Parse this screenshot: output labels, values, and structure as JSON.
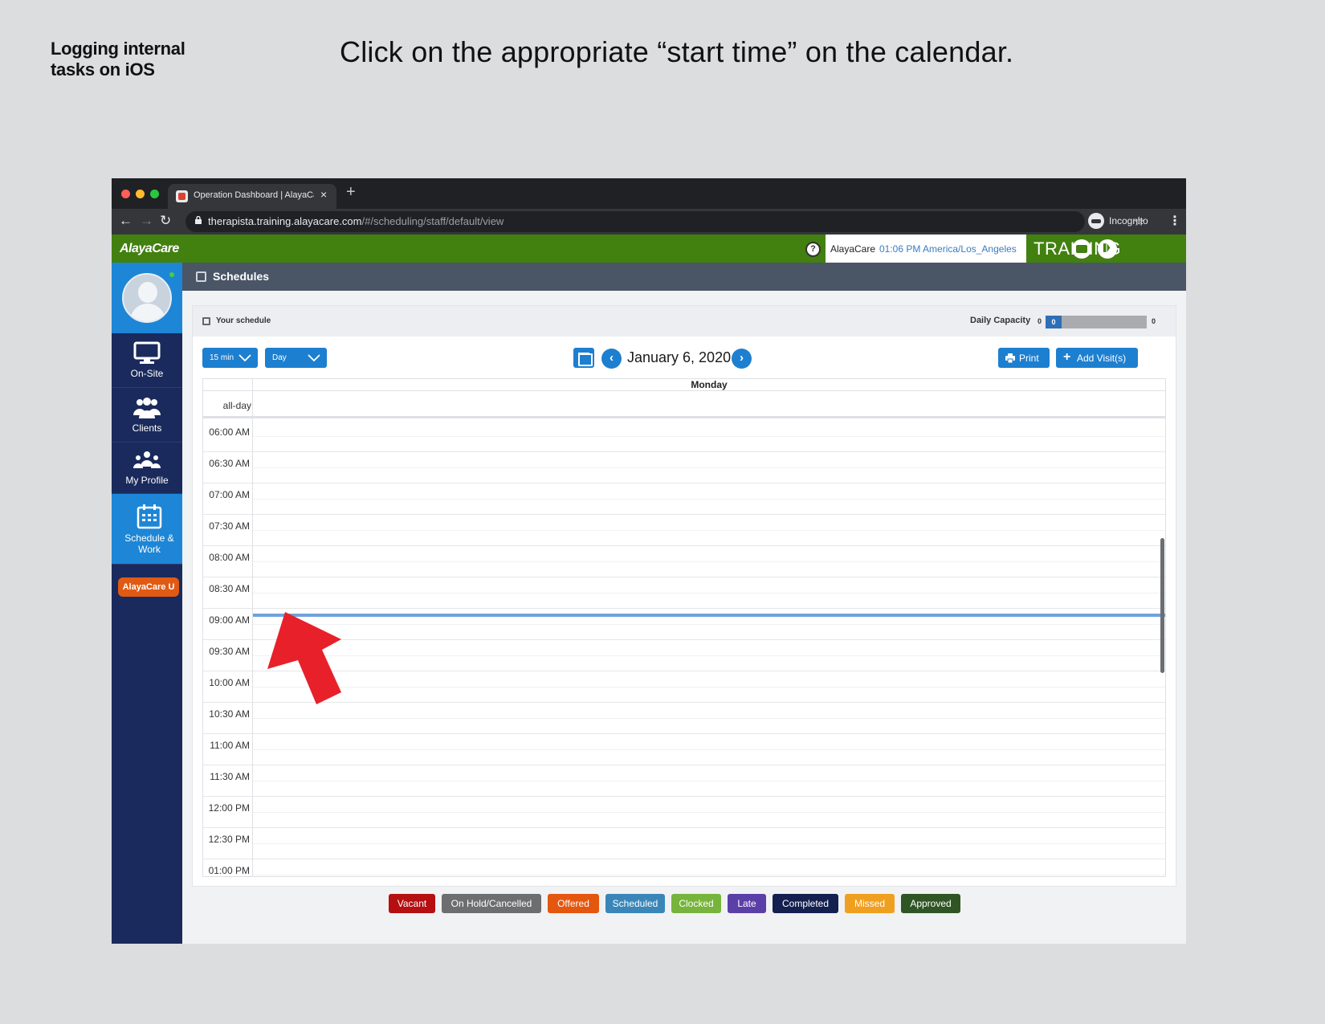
{
  "slide": {
    "tag": "Logging internal tasks on iOS",
    "instruction": "Click on the appropriate “start time” on the calendar."
  },
  "browser": {
    "tab_title": "Operation Dashboard | AlayaCare",
    "tab_close": "×",
    "new_tab": "+",
    "url_host": "therapista.training.alayacare.com",
    "url_path": "/#/scheduling/staff/default/view",
    "incognito_label": "Incognito",
    "back": "←",
    "forward": "→",
    "reload": "↻",
    "star": "☆",
    "kebab": "⋮"
  },
  "header": {
    "logo": "AlayaCare",
    "help": "?",
    "org": "AlayaCare",
    "time": "01:06 PM",
    "timezone": "America/Los_Angeles",
    "env": "TRAINING"
  },
  "sidebar": {
    "items": [
      {
        "label": "On-Site",
        "icon": "monitor-icon"
      },
      {
        "label": "Clients",
        "icon": "users-icon"
      },
      {
        "label": "My Profile",
        "icon": "group-icon"
      },
      {
        "label": "Schedule & Work",
        "icon": "calendar-icon",
        "active": true
      }
    ],
    "alaya_u": "AlayaCare U"
  },
  "page": {
    "title": "Schedules"
  },
  "panel": {
    "title": "Your schedule",
    "capacity_label": "Daily Capacity",
    "capacity_min": "0",
    "capacity_value": "0",
    "capacity_max": "0",
    "interval": "15 min",
    "view": "Day",
    "date": "January 6, 2020",
    "print": "Print",
    "add_visit": "Add Visit(s)",
    "prev": "‹",
    "next": "›"
  },
  "calendar": {
    "day": "Monday",
    "allday": "all-day",
    "times": [
      "06:00 AM",
      "06:30 AM",
      "07:00 AM",
      "07:30 AM",
      "08:00 AM",
      "08:30 AM",
      "09:00 AM",
      "09:30 AM",
      "10:00 AM",
      "10:30 AM",
      "11:00 AM",
      "11:30 AM",
      "12:00 PM",
      "12:30 PM",
      "01:00 PM"
    ]
  },
  "legend": [
    {
      "label": "Vacant",
      "color": "#b50f12"
    },
    {
      "label": "On Hold/Cancelled",
      "color": "#6d6e70"
    },
    {
      "label": "Offered",
      "color": "#e4570f"
    },
    {
      "label": "Scheduled",
      "color": "#3a86b9"
    },
    {
      "label": "Clocked",
      "color": "#76b43b"
    },
    {
      "label": "Late",
      "color": "#5b3fa8"
    },
    {
      "label": "Completed",
      "color": "#14204f"
    },
    {
      "label": "Missed",
      "color": "#f0a020"
    },
    {
      "label": "Approved",
      "color": "#2f5525"
    }
  ],
  "colors": {
    "accent": "#1d7fd0",
    "header_green": "#42800f",
    "sidebar": "#1a2a5c",
    "pointer_arrow": "#e8202a"
  }
}
